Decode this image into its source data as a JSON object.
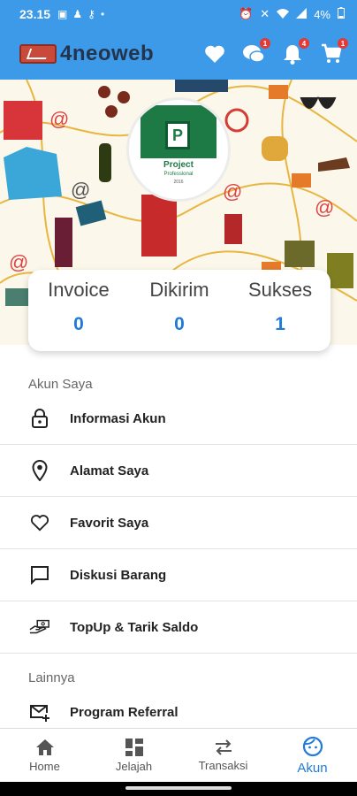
{
  "statusbar": {
    "time": "23.15",
    "battery": "4%"
  },
  "header": {
    "app_name": "4neoweb",
    "chat_badge": "1",
    "notif_badge": "4",
    "cart_badge": "1"
  },
  "banner": {
    "product_title": "Project",
    "product_subtitle": "Professional",
    "product_year": "2016"
  },
  "stats": [
    {
      "label": "Invoice",
      "value": "0"
    },
    {
      "label": "Dikirim",
      "value": "0"
    },
    {
      "label": "Sukses",
      "value": "1"
    }
  ],
  "sections": {
    "akun_saya": "Akun Saya",
    "lainnya": "Lainnya"
  },
  "menu": {
    "informasi_akun": "Informasi Akun",
    "alamat_saya": "Alamat Saya",
    "favorit_saya": "Favorit Saya",
    "diskusi_barang": "Diskusi Barang",
    "topup": "TopUp & Tarik Saldo",
    "program_referral": "Program Referral"
  },
  "bottom_nav": [
    {
      "label": "Home",
      "icon": "home-icon"
    },
    {
      "label": "Jelajah",
      "icon": "grid-icon"
    },
    {
      "label": "Transaksi",
      "icon": "swap-icon"
    },
    {
      "label": "Akun",
      "icon": "face-icon"
    }
  ],
  "colors": {
    "primary": "#3d9ae8",
    "accent": "#1f7ad8",
    "badge": "#e53935"
  }
}
